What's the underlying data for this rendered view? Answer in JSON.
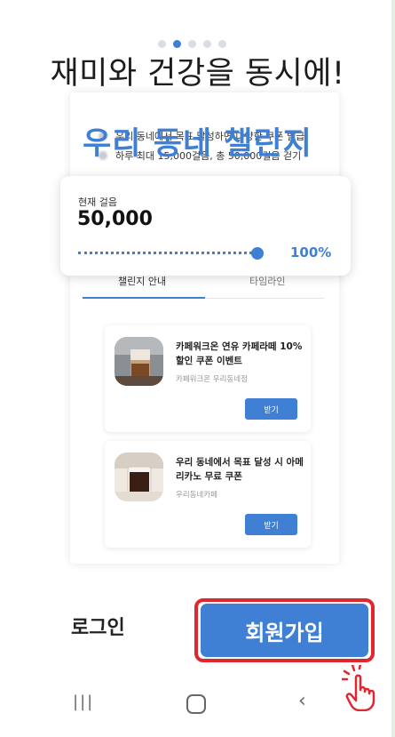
{
  "pager": {
    "count": 5,
    "active": 1
  },
  "headline": "재미와 건강을 동시에!",
  "challenge": {
    "title": "우리 동네 챌린지",
    "rules": [
      "우리 동네에서 목표 달성하면 다양한 쿠폰 발급",
      "하루 최대 15,000걸음, 총 50,000걸음 걷기"
    ]
  },
  "steps": {
    "label": "현재 걸음",
    "value": "50,000",
    "percent_text": "100%",
    "progress": 1.0
  },
  "tabs": [
    {
      "label": "챌린지 안내",
      "active": true
    },
    {
      "label": "타임라인",
      "active": false
    }
  ],
  "coupons": [
    {
      "title": "카페워크온 연유 카페라떼 10% 할인 쿠폰 이벤트",
      "store": "카페워크온 우리동네점",
      "button": "받기",
      "image": "iced-latte-photo"
    },
    {
      "title": "우리 동네에서 목표 달성 시 아메리카노 무료 쿠폰",
      "store": "우리동네카페",
      "button": "받기",
      "image": "americano-photo"
    }
  ],
  "actions": {
    "login": "로그인",
    "signup": "회원가입"
  },
  "nav": {
    "recent": "|||",
    "back": "‹"
  },
  "colors": {
    "accent": "#3f7fd4",
    "highlight": "#e2262f"
  }
}
